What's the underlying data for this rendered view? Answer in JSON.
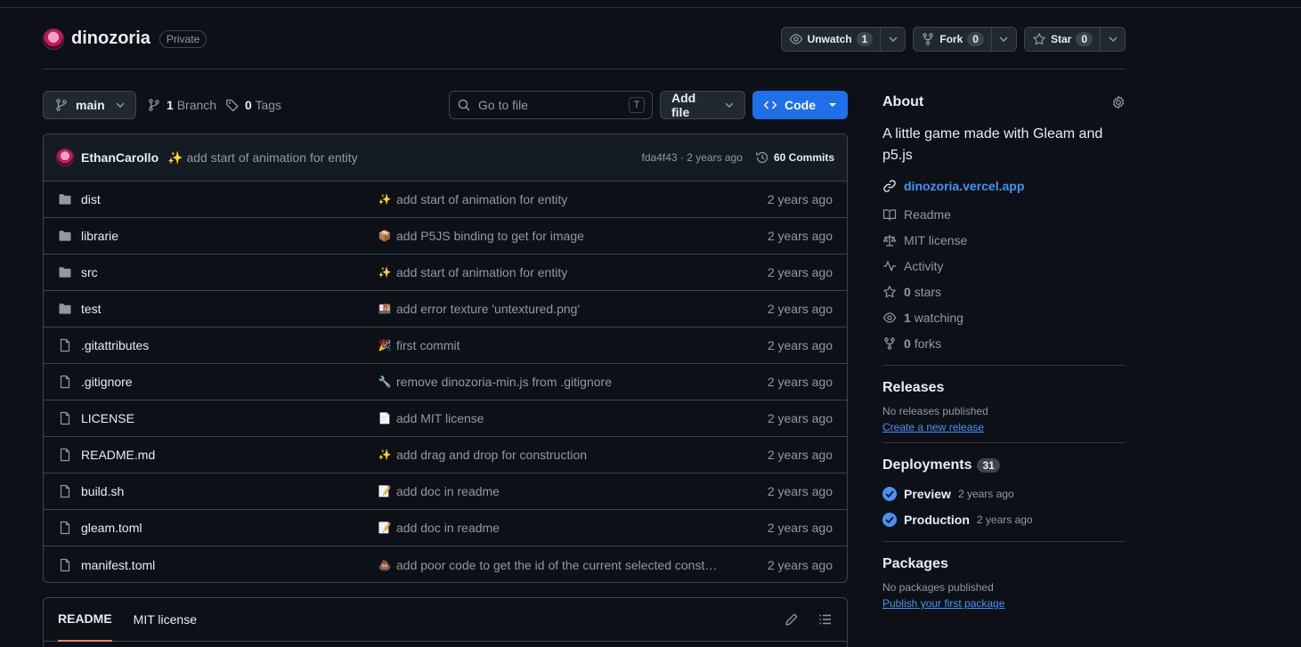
{
  "repo": {
    "name": "dinozoria",
    "visibility": "Private",
    "actions": [
      {
        "label": "Unwatch",
        "count": "1",
        "icon": "eye-icon"
      },
      {
        "label": "Fork",
        "count": "0",
        "icon": "fork-icon"
      },
      {
        "label": "Star",
        "count": "0",
        "icon": "star-icon"
      }
    ]
  },
  "nav": {
    "branch": "main",
    "branches_count": "1",
    "branches_label": "Branch",
    "tags_count": "0",
    "tags_label": "Tags",
    "goto_placeholder": "Go to file",
    "goto_shortcut": "T",
    "add_file": "Add file",
    "code": "Code"
  },
  "latest_commit": {
    "author": "EthanCarollo",
    "emoji": "✨",
    "message": "add start of animation for entity",
    "sha_time": "fda4f43 · 2 years ago",
    "commits_label": "60 Commits"
  },
  "files": [
    {
      "name": "dist",
      "type": "folder",
      "emoji": "✨",
      "message": "add start of animation for entity",
      "time": "2 years ago"
    },
    {
      "name": "librarie",
      "type": "folder",
      "emoji": "📦",
      "message": "add P5JS binding to get for image",
      "time": "2 years ago"
    },
    {
      "name": "src",
      "type": "folder",
      "emoji": "✨",
      "message": "add start of animation for entity",
      "time": "2 years ago"
    },
    {
      "name": "test",
      "type": "folder",
      "emoji": "🍱",
      "message": "add error texture 'untextured.png'",
      "time": "2 years ago"
    },
    {
      "name": ".gitattributes",
      "type": "file",
      "emoji": "🎉",
      "message": "first commit",
      "time": "2 years ago"
    },
    {
      "name": ".gitignore",
      "type": "file",
      "emoji": "🔧",
      "message": "remove dinozoria-min.js from .gitignore",
      "time": "2 years ago"
    },
    {
      "name": "LICENSE",
      "type": "file",
      "emoji": "📄",
      "message": "add MIT license",
      "time": "2 years ago"
    },
    {
      "name": "README.md",
      "type": "file",
      "emoji": "✨",
      "message": "add drag and drop for construction",
      "time": "2 years ago"
    },
    {
      "name": "build.sh",
      "type": "file",
      "emoji": "📝",
      "message": "add doc in readme",
      "time": "2 years ago"
    },
    {
      "name": "gleam.toml",
      "type": "file",
      "emoji": "📝",
      "message": "add doc in readme",
      "time": "2 years ago"
    },
    {
      "name": "manifest.toml",
      "type": "file",
      "emoji": "💩",
      "message": "add poor code to get the id of the current selected const…",
      "time": "2 years ago"
    }
  ],
  "readme_tabs": [
    "README",
    "MIT license"
  ],
  "about": {
    "heading": "About",
    "description": "A little game made with Gleam and p5.js",
    "website": "dinozoria.vercel.app",
    "items": [
      {
        "icon": "book-icon",
        "label": "Readme"
      },
      {
        "icon": "scale-icon",
        "label": "MIT license"
      },
      {
        "icon": "pulse-icon",
        "label": "Activity"
      },
      {
        "icon": "star-icon",
        "count": "0",
        "label": "stars"
      },
      {
        "icon": "eye-icon",
        "count": "1",
        "label": "watching"
      },
      {
        "icon": "fork-icon",
        "count": "0",
        "label": "forks"
      }
    ]
  },
  "releases": {
    "heading": "Releases",
    "empty": "No releases published",
    "link": "Create a new release"
  },
  "deployments": {
    "heading": "Deployments",
    "count": "31",
    "items": [
      {
        "name": "Preview",
        "time": "2 years ago"
      },
      {
        "name": "Production",
        "time": "2 years ago"
      }
    ]
  },
  "packages": {
    "heading": "Packages",
    "empty": "No packages published",
    "link": "Publish your first package"
  },
  "colors": {
    "background": "#0d1117",
    "accent": "#1f6feb",
    "link": "#4493f8",
    "muted": "#9198a1"
  }
}
